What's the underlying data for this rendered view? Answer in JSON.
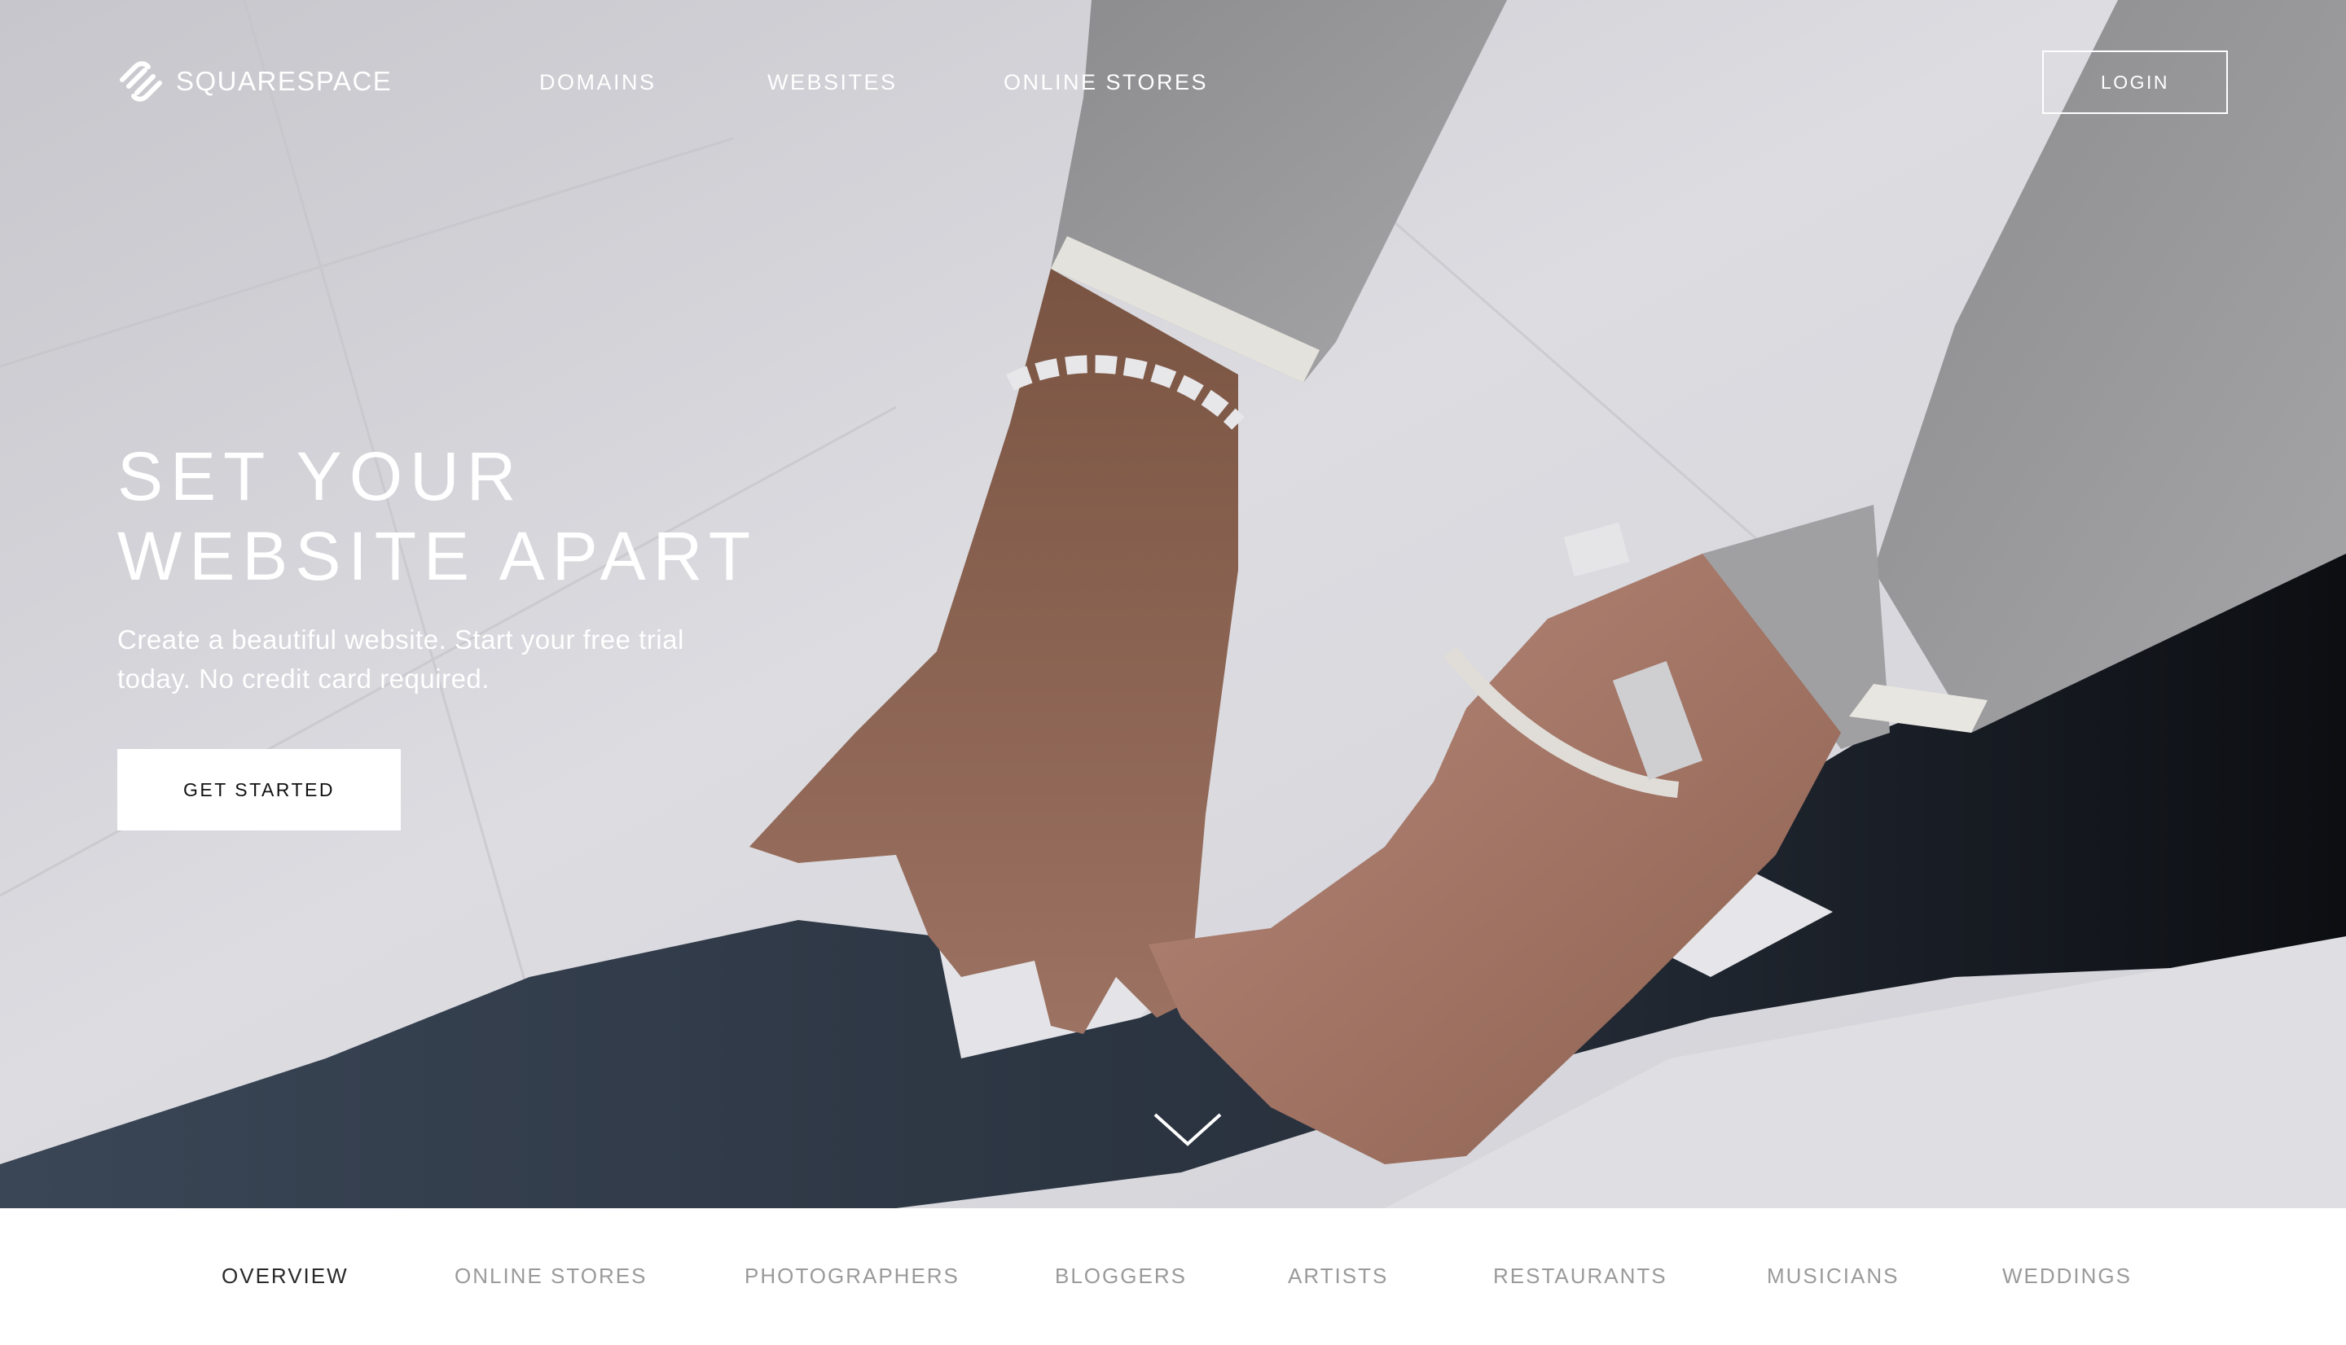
{
  "brand": {
    "name": "SQUARESPACE",
    "logo_icon": "squarespace-logo-icon"
  },
  "nav": {
    "items": [
      {
        "label": "DOMAINS"
      },
      {
        "label": "WEBSITES"
      },
      {
        "label": "ONLINE STORES"
      }
    ],
    "login_label": "LOGIN"
  },
  "hero": {
    "title_line_1": "SET YOUR",
    "title_line_2": "WEBSITE APART",
    "subtitle": "Create a beautiful website. Start your free trial today. No credit card required.",
    "cta_label": "GET STARTED",
    "scroll_icon": "chevron-down-icon"
  },
  "subnav": {
    "items": [
      {
        "label": "OVERVIEW",
        "active": true
      },
      {
        "label": "ONLINE STORES",
        "active": false
      },
      {
        "label": "PHOTOGRAPHERS",
        "active": false
      },
      {
        "label": "BLOGGERS",
        "active": false
      },
      {
        "label": "ARTISTS",
        "active": false
      },
      {
        "label": "RESTAURANTS",
        "active": false
      },
      {
        "label": "MUSICIANS",
        "active": false
      },
      {
        "label": "WEDDINGS",
        "active": false
      }
    ]
  },
  "colors": {
    "text_on_hero": "#ffffff",
    "subnav_active": "#2a2a2a",
    "subnav_inactive": "#9a9a9a",
    "cta_background": "#ffffff"
  }
}
